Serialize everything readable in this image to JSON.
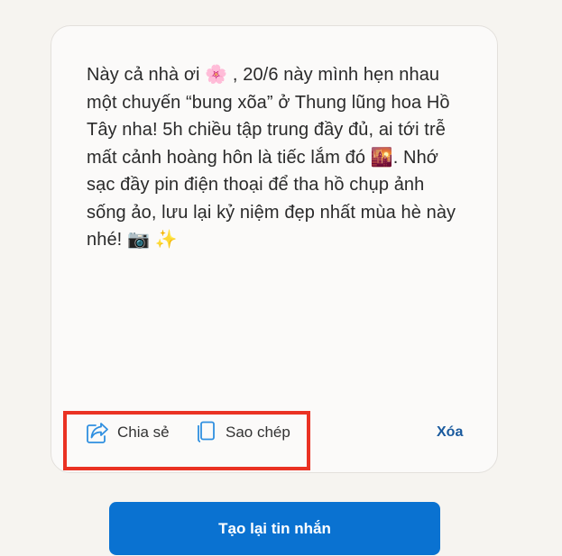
{
  "message": {
    "text": "Này cả nhà ơi 🌸 , 20/6 này mình hẹn nhau một chuyến “bung xõa” ở Thung lũng hoa Hồ Tây nha! 5h chiều tập trung đầy đủ, ai tới trễ mất cảnh hoàng hôn là tiếc lắm đó 🌇. Nhớ sạc đầy pin điện thoại để tha hồ chụp ảnh sống ảo, lưu lại kỷ niệm đẹp nhất mùa hè này nhé! 📷 ✨"
  },
  "actions": {
    "share_label": "Chia sẻ",
    "copy_label": "Sao chép",
    "delete_label": "Xóa"
  },
  "regenerate": {
    "label": "Tạo lại tin nhắn"
  },
  "icons": {
    "share": "share-icon",
    "copy": "copy-icon"
  },
  "colors": {
    "accent": "#0a72d1",
    "delete_link": "#1a5a9e",
    "highlight_border": "#ea3223",
    "icon": "#2f8fe0"
  }
}
